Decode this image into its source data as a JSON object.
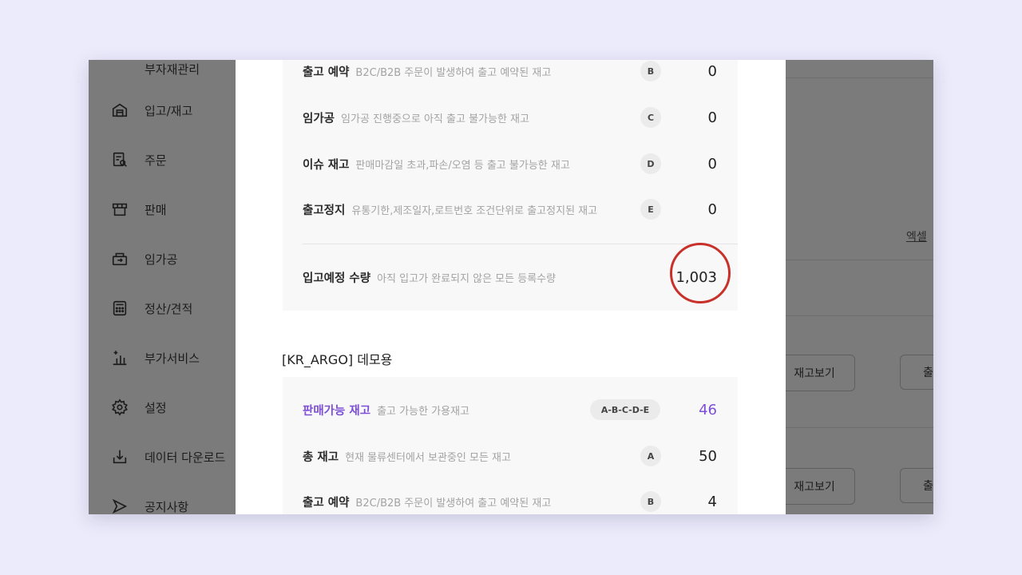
{
  "sidebar": {
    "partial_item": "부자재관리",
    "items": [
      {
        "label": "입고/재고",
        "icon": "warehouse-icon"
      },
      {
        "label": "주문",
        "icon": "order-search-icon"
      },
      {
        "label": "판매",
        "icon": "store-icon"
      },
      {
        "label": "임가공",
        "icon": "box-process-icon"
      },
      {
        "label": "정산/견적",
        "icon": "calculator-icon"
      },
      {
        "label": "부가서비스",
        "icon": "chart-plus-icon"
      },
      {
        "label": "설정",
        "icon": "gear-icon"
      },
      {
        "label": "데이터 다운로드",
        "icon": "download-icon"
      },
      {
        "label": "공지사항",
        "icon": "megaphone-icon"
      }
    ]
  },
  "background": {
    "excel_link": "엑셀",
    "view_stock_button": "재고보기",
    "partial_button": "출"
  },
  "modal": {
    "top_panel": {
      "rows": [
        {
          "label": "출고 예약",
          "desc": "B2C/B2B 주문이 발생하여 출고 예약된 재고",
          "code": "B",
          "value": "0"
        },
        {
          "label": "임가공",
          "desc": "임가공 진행중으로 아직 출고 불가능한 재고",
          "code": "C",
          "value": "0"
        },
        {
          "label": "이슈 재고",
          "desc": "판매마감일 초과,파손/오염 등 출고 불가능한 재고",
          "code": "D",
          "value": "0"
        },
        {
          "label": "출고정지",
          "desc": "유통기한,제조일자,로트번호 조건단위로 출고정지된 재고",
          "code": "E",
          "value": "0"
        }
      ],
      "incoming": {
        "label": "입고예정 수량",
        "desc": "아직 입고가 완료되지 않은 모든 등록수량",
        "value": "1,003"
      }
    },
    "section_title": "[KR_ARGO] 데모용",
    "bottom_panel": {
      "rows": [
        {
          "label": "판매가능 재고",
          "desc": "출고 가능한 가용재고",
          "code": "A-B-C-D-E",
          "value": "46",
          "accent": true
        },
        {
          "label": "총 재고",
          "desc": "현재 물류센터에서 보관중인 모든 재고",
          "code": "A",
          "value": "50"
        },
        {
          "label": "출고 예약",
          "desc": "B2C/B2B 주문이 발생하여 출고 예약된 재고",
          "code": "B",
          "value": "4"
        }
      ]
    },
    "colors": {
      "accent": "#7c4fd6",
      "highlight_circle": "#c8302a"
    }
  }
}
